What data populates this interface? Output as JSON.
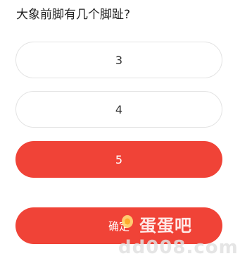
{
  "question": "大象前脚有几个脚趾?",
  "options": [
    {
      "label": "3",
      "selected": false
    },
    {
      "label": "4",
      "selected": false
    },
    {
      "label": "5",
      "selected": true
    }
  ],
  "confirm_label": "确定",
  "watermark": {
    "text": "蛋蛋吧",
    "url": "dd008.com"
  },
  "colors": {
    "accent": "#f04337",
    "option_border": "#e3e3e3",
    "text": "#222222"
  }
}
